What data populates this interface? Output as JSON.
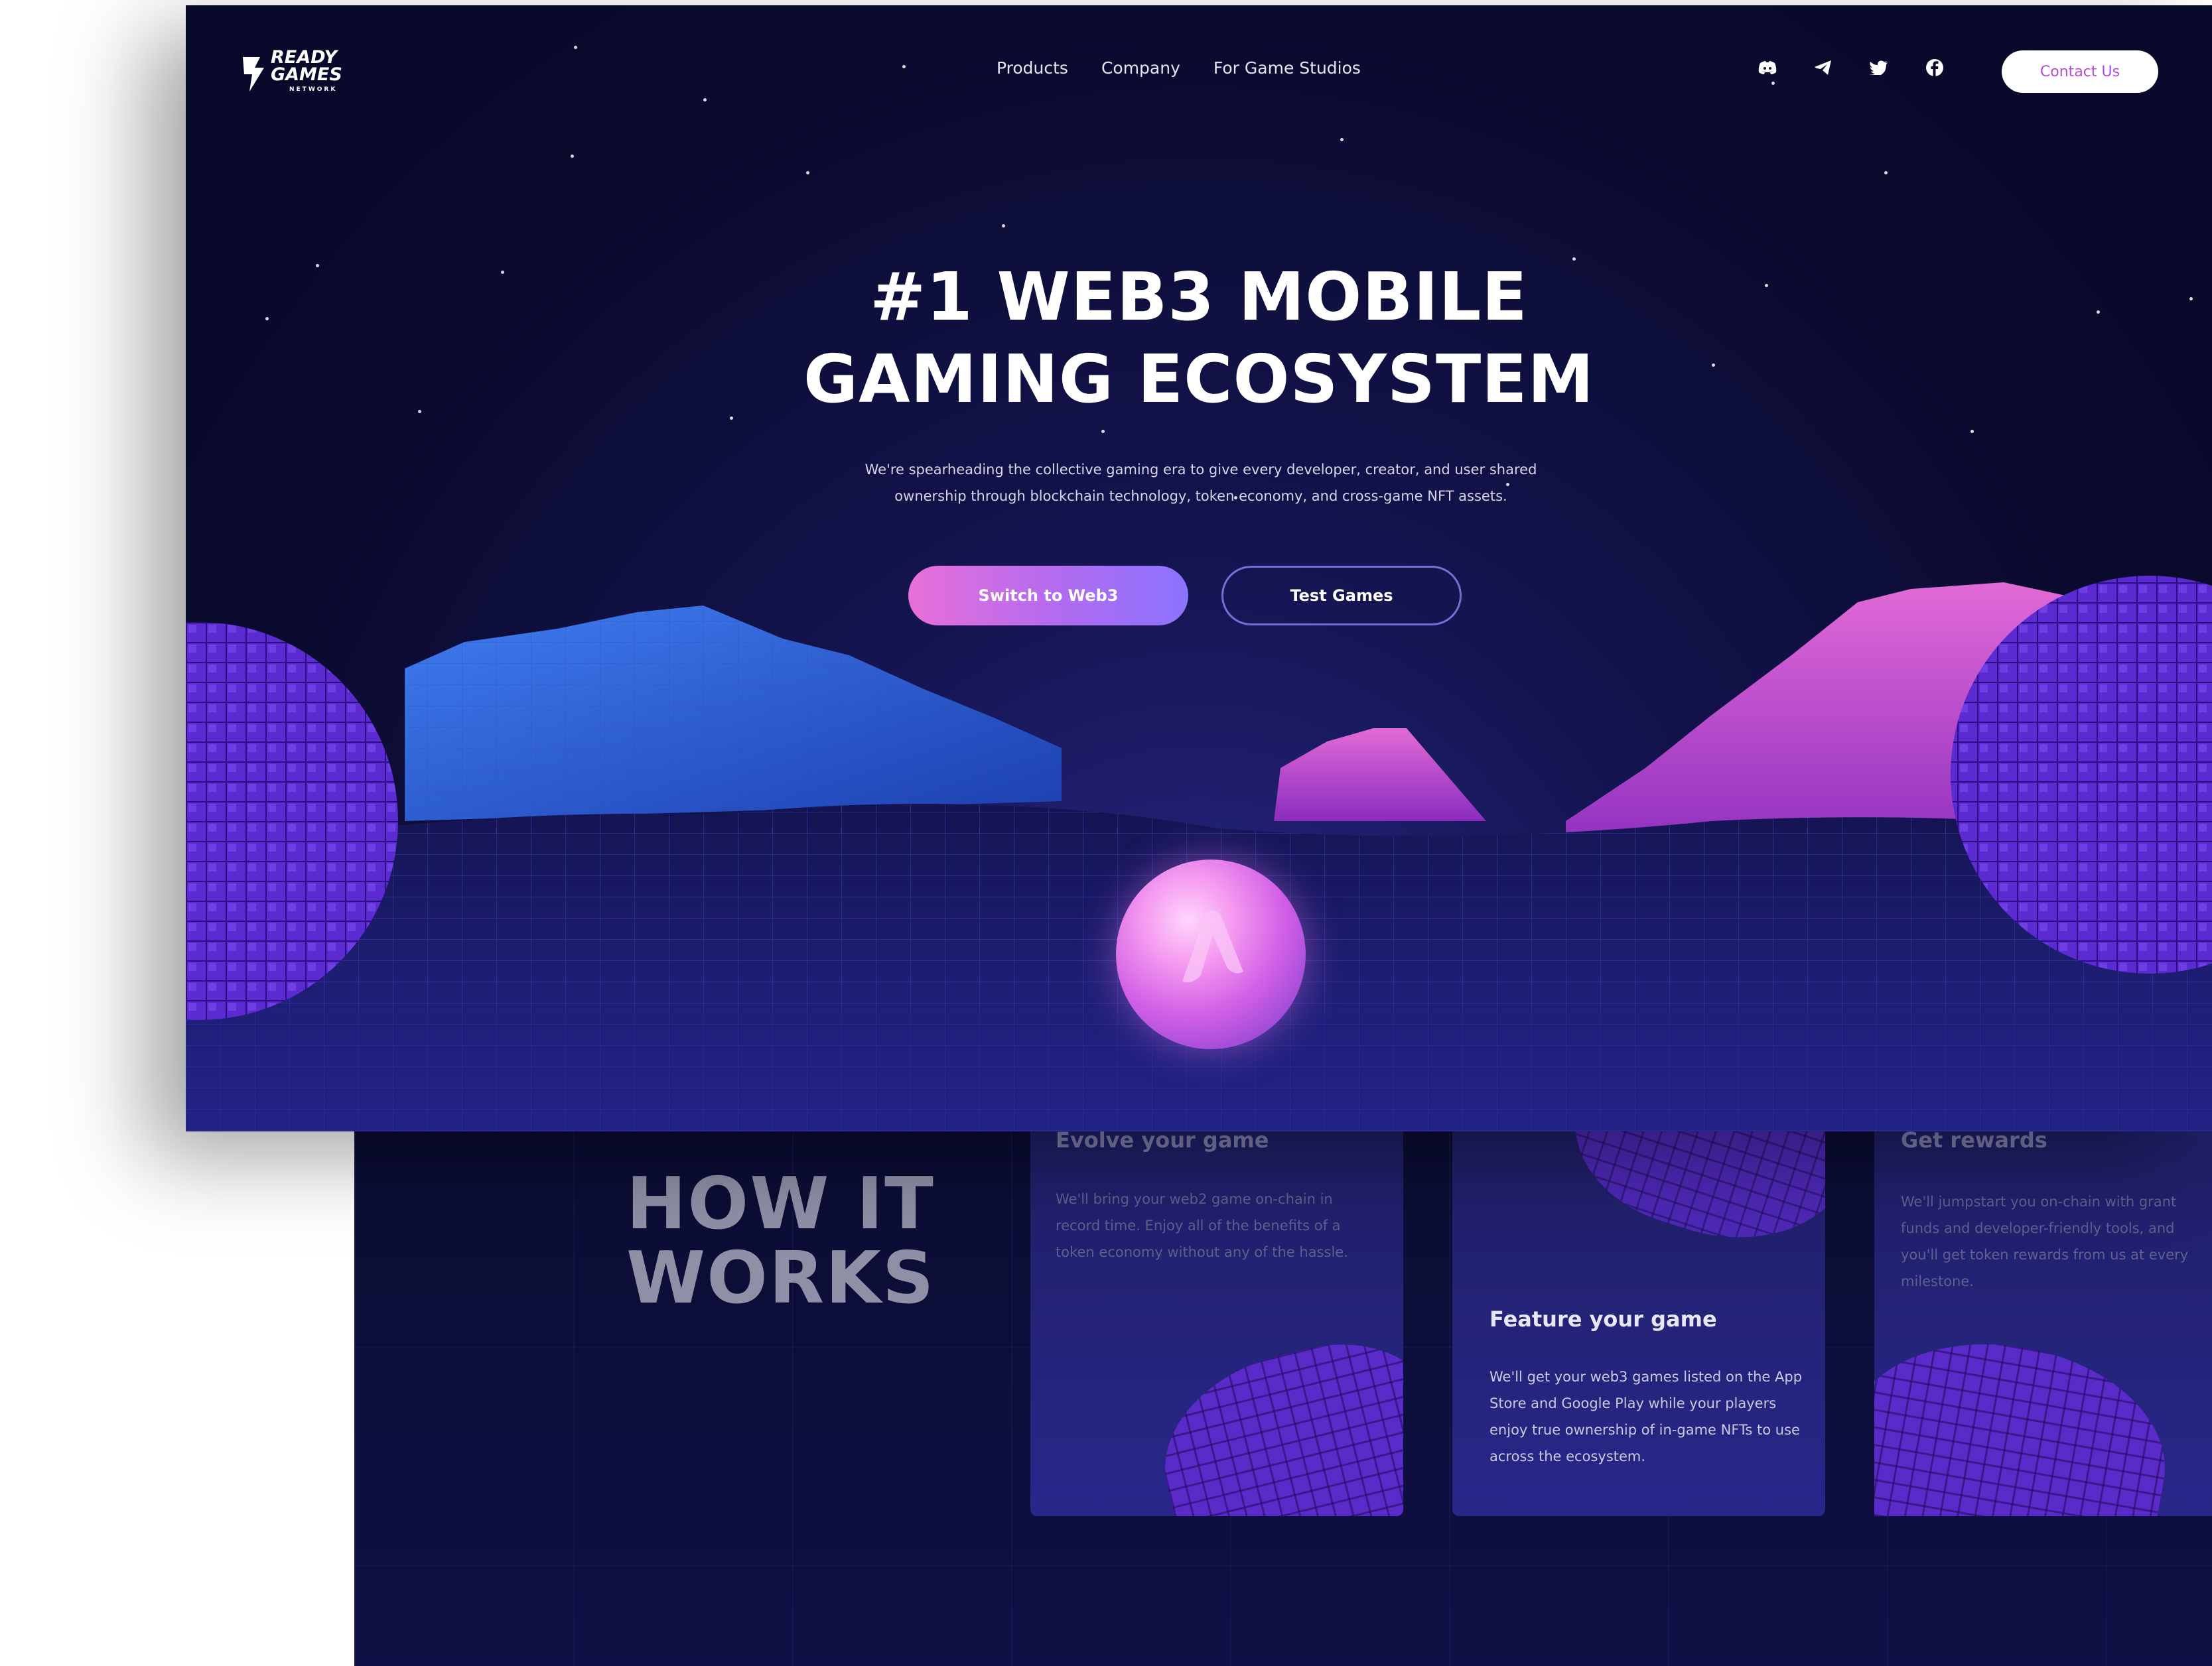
{
  "nav": {
    "logo_line1": "READY",
    "logo_line2": "GAMES",
    "logo_sub": "NETWORK",
    "links": [
      "Products",
      "Company",
      "For Game Studios"
    ],
    "social_icons": [
      "discord-icon",
      "telegram-icon",
      "twitter-icon",
      "facebook-icon"
    ],
    "contact_label": "Contact Us"
  },
  "hero": {
    "title_line1": "#1 WEB3 MOBILE",
    "title_line2": "GAMING ECOSYSTEM",
    "subtitle": "We're spearheading the collective gaming era to give every developer, creator, and user shared ownership through blockchain technology, token economy, and cross-game NFT assets.",
    "primary_cta": "Switch to Web3",
    "secondary_cta": "Test Games"
  },
  "how_it_works": {
    "title": "HOW IT\nWORKS",
    "cards": [
      {
        "title": "Evolve your game",
        "text": "We'll bring your web2 game on-chain in record time. Enjoy all of the benefits of a token economy without any of the hassle."
      },
      {
        "title": "Feature your game",
        "text": "We'll get your web3 games listed on the App Store and Google Play while your players enjoy true ownership of in-game NFTs to use across the ecosystem."
      },
      {
        "title": "Get rewards",
        "text": "We'll jumpstart you on-chain with grant funds and developer-friendly tools, and you'll get token rewards from us at every milestone."
      }
    ]
  },
  "colors": {
    "background": "#0a0a2e",
    "accent_pink": "#e96fd9",
    "accent_purple": "#8b73ff",
    "contact_text": "#b14ddd",
    "voxel_purple": "#5a2bc9"
  }
}
